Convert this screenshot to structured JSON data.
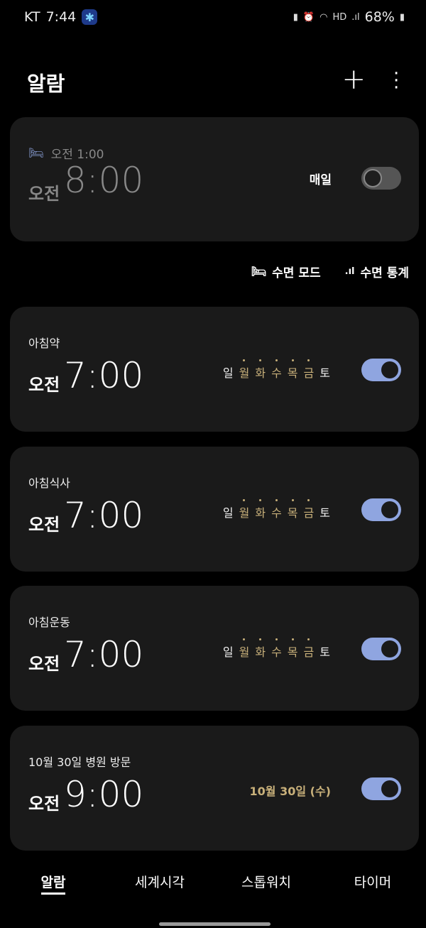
{
  "status": {
    "carrier": "KT",
    "time": "7:44",
    "battery": "68%"
  },
  "header": {
    "title": "알람",
    "add_icon": "+",
    "more_icon": "⋮"
  },
  "bedtime": {
    "sleep_label": "오전 1:00",
    "ampm": "오전",
    "time": "8:00",
    "repeat": "매일",
    "enabled": false
  },
  "links": {
    "sleep_mode": "수면 모드",
    "sleep_stats": "수면 통계"
  },
  "days": [
    "일",
    "월",
    "화",
    "수",
    "목",
    "금",
    "토"
  ],
  "active_days": [
    false,
    true,
    true,
    true,
    true,
    true,
    false
  ],
  "alarms": [
    {
      "label": "아침약",
      "ampm": "오전",
      "time": "7:00",
      "enabled": true
    },
    {
      "label": "아침식사",
      "ampm": "오전",
      "time": "7:00",
      "enabled": true
    },
    {
      "label": "아침운동",
      "ampm": "오전",
      "time": "7:00",
      "enabled": true
    },
    {
      "label": "10월 30일 병원 방문",
      "ampm": "오전",
      "time": "9:00",
      "date": "10월 30일 (수)",
      "enabled": true
    }
  ],
  "nav": [
    "알람",
    "세계시각",
    "스톱워치",
    "타이머"
  ],
  "colors": {
    "accent": "#8fa5e0",
    "day_active": "#c8b07a"
  }
}
